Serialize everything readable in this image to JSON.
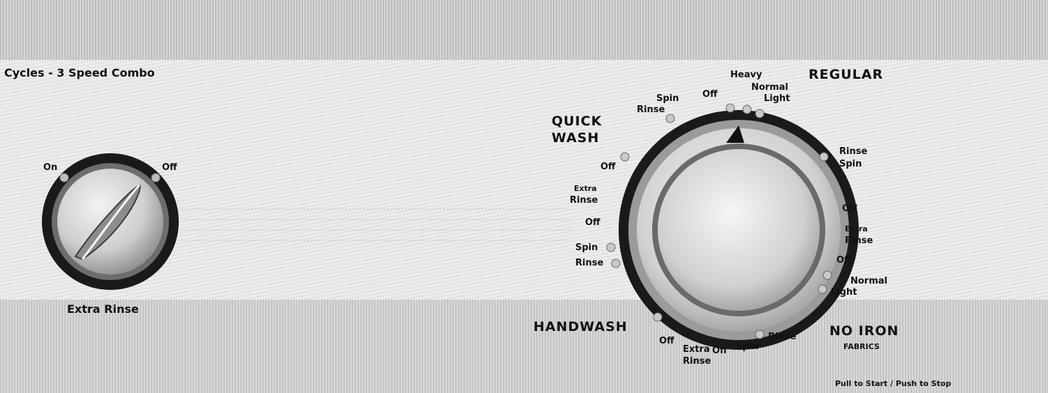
{
  "panel": {
    "title": "Cycles - 3 Speed Combo",
    "footer_hint": "Pull to Start / Push to Stop"
  },
  "extra_rinse_knob": {
    "label": "Extra Rinse",
    "positions": [
      "On",
      "Off"
    ]
  },
  "cycle_dial": {
    "sections": {
      "regular": "REGULAR",
      "quick_wash": "QUICK WASH",
      "handwash": "HANDWASH",
      "no_iron": "NO IRON",
      "no_iron_sub": "FABRICS"
    },
    "marks": {
      "top_off": "Off",
      "top_heavy": "Heavy",
      "top_normal": "Normal",
      "top_light": "Light",
      "qw_spin": "Spin",
      "qw_rinse": "Rinse",
      "right_rinse": "Rinse",
      "right_spin": "Spin",
      "right_off1": "Off",
      "right_extra": "Extra",
      "right_rinse2": "Rinse",
      "right_off2": "Off",
      "right_normal": "Normal",
      "right_light": "Light",
      "left_off1": "Off",
      "left_extra": "Extra",
      "left_rinse": "Rinse",
      "left_off2": "Off",
      "left_spin": "Spin",
      "left_rinse2": "Rinse",
      "bot_off1": "Off",
      "bot_extra": "Extra",
      "bot_rinse": "Rinse",
      "bot_off2": "Off",
      "bot_spin": "Spin",
      "bot_rinse2": "Rinse"
    }
  }
}
